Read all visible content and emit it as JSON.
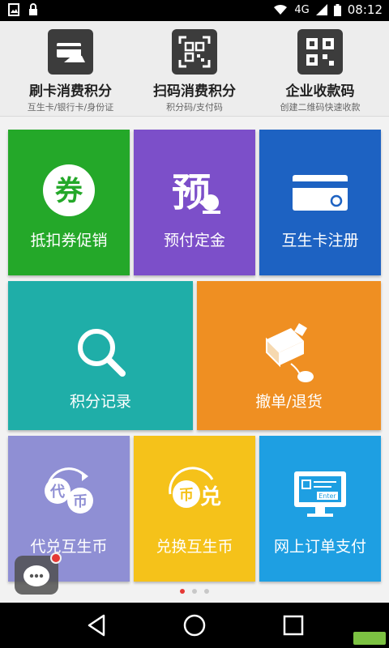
{
  "status": {
    "network": "4G",
    "time": "08:12"
  },
  "quick": [
    {
      "label": "刷卡消费积分",
      "sub": "互生卡/银行卡/身份证"
    },
    {
      "label": "扫码消费积分",
      "sub": "积分码/支付码"
    },
    {
      "label": "企业收款码",
      "sub": "创建二维码快速收款"
    }
  ],
  "tiles": {
    "coupon": {
      "label": "抵扣券促销",
      "icon_char": "券"
    },
    "prepay": {
      "label": "预付定金",
      "icon_char": "预"
    },
    "card": {
      "label": "互生卡注册"
    },
    "points": {
      "label": "积分记录"
    },
    "refund": {
      "label": "撤单/退货"
    },
    "exch1": {
      "label": "代兑互生币",
      "icon_chars": [
        "代",
        "币"
      ]
    },
    "exch2": {
      "label": "兑换互生币",
      "icon_chars": [
        "币",
        "兑"
      ]
    },
    "online": {
      "label": "网上订单支付",
      "icon_text": "Enter"
    }
  },
  "colors": {
    "green": "#24a829",
    "purple": "#7c4fc9",
    "blue": "#1d62c2",
    "teal": "#1faea8",
    "orange": "#ef8f22",
    "lavender": "#8f8fd4",
    "yellow": "#f5c21a",
    "sky": "#1e9fe2"
  },
  "pager": {
    "count": 3,
    "active": 0
  }
}
